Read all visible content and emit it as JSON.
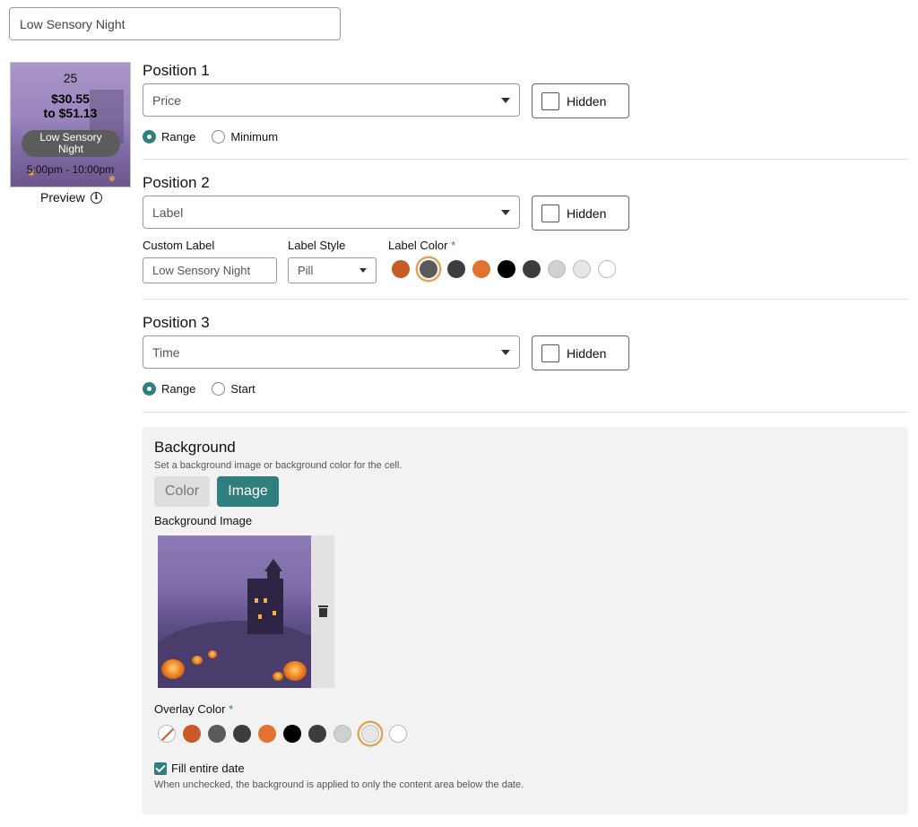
{
  "title_input": {
    "value": "Low Sensory Night"
  },
  "preview": {
    "day": "25",
    "price_line1": "$30.55",
    "price_line2": "to $51.13",
    "pill": "Low Sensory Night",
    "time": "5:00pm - 10:00pm",
    "label": "Preview"
  },
  "position1": {
    "title": "Position 1",
    "select": "Price",
    "hidden_label": "Hidden",
    "radios": [
      {
        "label": "Range",
        "checked": true
      },
      {
        "label": "Minimum",
        "checked": false
      }
    ]
  },
  "position2": {
    "title": "Position 2",
    "select": "Label",
    "hidden_label": "Hidden",
    "custom_label_title": "Custom Label",
    "custom_label_value": "Low Sensory Night",
    "label_style_title": "Label Style",
    "label_style_value": "Pill",
    "label_color_title": "Label Color",
    "required_mark": "*",
    "colors": [
      "#c85a26",
      "#5a5a5a",
      "#3d3d3d",
      "#e2722f",
      "#000000",
      "#3d3d3d",
      "#d0d0d0",
      "#e6e6e6",
      "#ffffff"
    ],
    "selected_color_index": 1
  },
  "position3": {
    "title": "Position 3",
    "select": "Time",
    "hidden_label": "Hidden",
    "radios": [
      {
        "label": "Range",
        "checked": true
      },
      {
        "label": "Start",
        "checked": false
      }
    ]
  },
  "background": {
    "title": "Background",
    "subtitle": "Set a background image or background color for the cell.",
    "tab_color": "Color",
    "tab_image": "Image",
    "active_tab": "Image",
    "image_label": "Background Image",
    "overlay_label": "Overlay Color",
    "required_mark": "*",
    "overlay_colors": [
      "none",
      "#c85a26",
      "#5a5a5a",
      "#3d3d3d",
      "#e2722f",
      "#000000",
      "#3d3d3d",
      "#d0d0d0",
      "#e6e6e6",
      "#ffffff"
    ],
    "selected_overlay_index": 8,
    "fill_label": "Fill entire date",
    "fill_checked": true,
    "fill_help": "When unchecked, the background is applied to only the content area below the date."
  }
}
